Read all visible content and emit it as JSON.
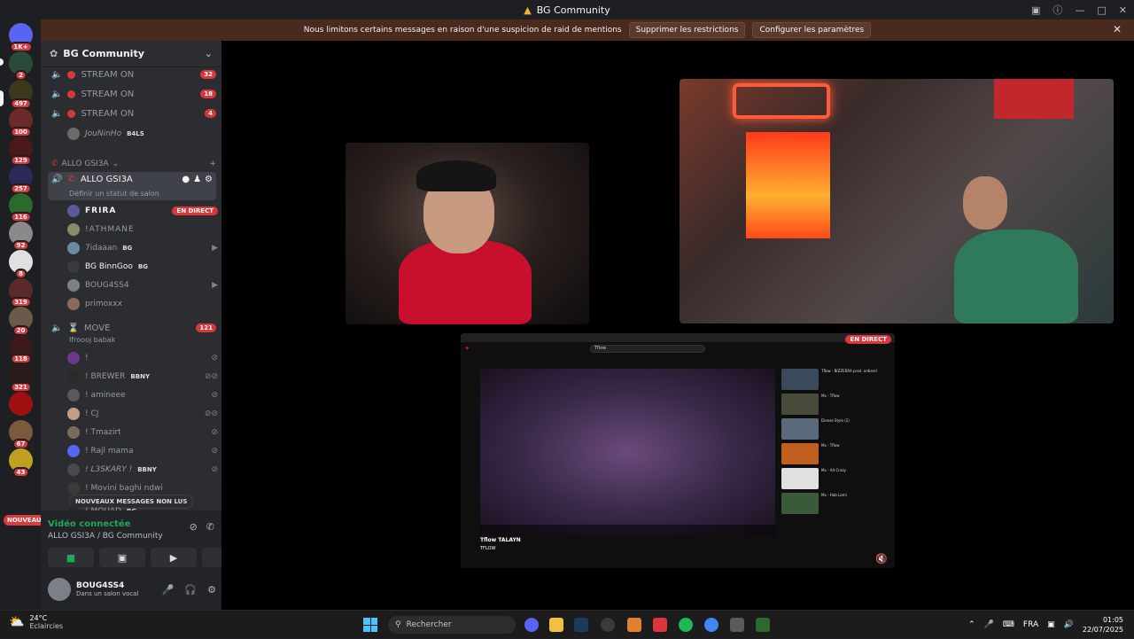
{
  "window": {
    "title": "BG Community"
  },
  "banner": {
    "text": "Nous limitons certains messages en raison d'une suspicion de raid de mentions",
    "btn1": "Supprimer les restrictions",
    "btn2": "Configurer les paramètres"
  },
  "rail": {
    "badges": [
      "1K+",
      "2",
      "497",
      "100",
      "129",
      "257",
      "116",
      "92",
      "8",
      "319",
      "20",
      "118",
      "321",
      "67",
      "43"
    ],
    "nouveau": "NOUVEAU"
  },
  "guild": {
    "name": "BG Community"
  },
  "channels": {
    "stream1": {
      "name": "STREAM ON",
      "count": "32"
    },
    "stream2": {
      "name": "STREAM ON",
      "count": "18"
    },
    "stream3": {
      "name": "STREAM ON",
      "count": "4"
    },
    "stream_user": {
      "name": "JouNinHo",
      "tag": "B4LS"
    },
    "category": "ALLO GSI3A",
    "allo": {
      "name": "ALLO GSI3A",
      "status": "Définir un statut de salon"
    },
    "users": [
      {
        "name": "FRIRA",
        "badge": "EN DIRECT"
      },
      {
        "name": "!ATHMANE"
      },
      {
        "name": "7idaaan",
        "tag": "BG"
      },
      {
        "name": "BG BinnGoo",
        "tag": "BG"
      },
      {
        "name": "BOUG4SS4"
      },
      {
        "name": "primoxxx"
      }
    ],
    "move": {
      "name": "MOVE",
      "count": "121",
      "status": "Ifroooj babak"
    },
    "move_users": [
      {
        "name": "!"
      },
      {
        "name": "! BREWER",
        "tag": "BBNY"
      },
      {
        "name": "! amineee"
      },
      {
        "name": "! CJ"
      },
      {
        "name": "! Tmazirt"
      },
      {
        "name": "! Rajl mama"
      },
      {
        "name": "! L3SKARY !",
        "tag": "BBNY"
      },
      {
        "name": "! Movini baghi ndwi"
      },
      {
        "name": "! MOUAD",
        "tag": "BG"
      }
    ],
    "new_messages": "NOUVEAUX MESSAGES NON LUS"
  },
  "voice": {
    "connected": "Vidéo connectée",
    "location": "ALLO GSI3A / BG Community"
  },
  "me": {
    "name": "BOUG4SS4",
    "status": "Dans un salon vocal"
  },
  "stream": {
    "live_badge": "EN DIRECT",
    "yt_search": "Tflow",
    "yt_title": "Tflow TALAYN",
    "yt_channel": "TFLOW",
    "side_items": [
      "Tflow - BIZZERRA prod. ordiarel",
      "Mx - Tflow",
      "Dieese Style (2)",
      "Mx - Tflow",
      "Mx - Alt Crazy",
      "Mx - Hab Lami"
    ]
  },
  "taskbar": {
    "temp": "24°C",
    "weather": "Eclaircies",
    "search": "Rechercher",
    "lang": "FRA",
    "time": "01:05",
    "date": "22/07/2025"
  }
}
